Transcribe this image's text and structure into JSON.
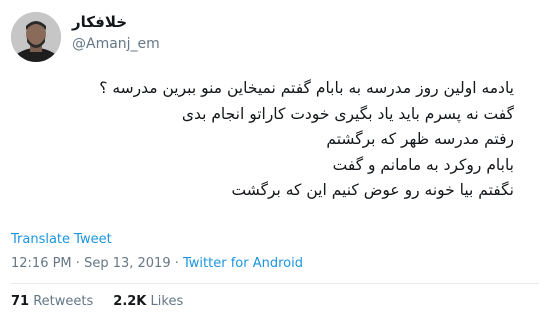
{
  "author": {
    "display_name": "خلافکار",
    "handle": "@Amanj_em"
  },
  "tweet": {
    "lines": [
      "یادمه اولین روز مدرسه به بابام گفتم نمیخاین منو ببرین مدرسه ؟",
      "گفت نه پسرم باید یاد بگیری خودت کاراتو انجام بدی",
      "رفتم مدرسه ظهر که برگشتم",
      "بابام روکرد به مامانم و گفت",
      "نگفتم بیا خونه رو عوض کنیم این که برگشت"
    ]
  },
  "actions": {
    "translate_label": "Translate Tweet"
  },
  "meta": {
    "time": "12:16 PM",
    "separator": " · ",
    "date": "Sep 13, 2019",
    "source": "Twitter for Android"
  },
  "stats": {
    "retweets_count": "71",
    "retweets_label": "Retweets",
    "likes_count": "2.2K",
    "likes_label": "Likes"
  }
}
